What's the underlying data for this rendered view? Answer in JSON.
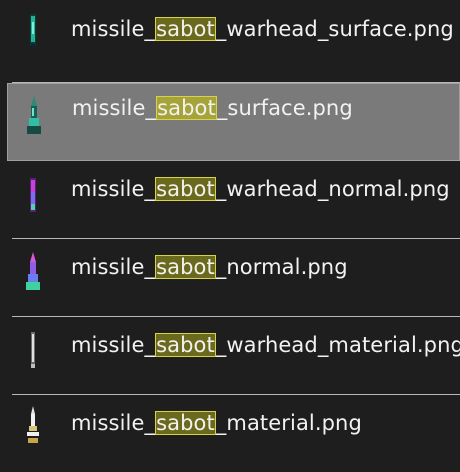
{
  "files": [
    {
      "prefix": "missile_",
      "match": "sabot",
      "suffix": "_warhead_surface.png",
      "selected": false,
      "icon": "warhead-surface-thumb"
    },
    {
      "prefix": "missile_",
      "match": "sabot",
      "suffix": "_surface.png",
      "selected": true,
      "icon": "missile-surface-thumb"
    },
    {
      "prefix": "missile_",
      "match": "sabot",
      "suffix": "_warhead_normal.png",
      "selected": false,
      "icon": "warhead-normal-thumb"
    },
    {
      "prefix": "missile_",
      "match": "sabot",
      "suffix": "_normal.png",
      "selected": false,
      "icon": "missile-normal-thumb"
    },
    {
      "prefix": "missile_",
      "match": "sabot",
      "suffix": "_warhead_material.png",
      "selected": false,
      "icon": "warhead-material-thumb"
    },
    {
      "prefix": "missile_",
      "match": "sabot",
      "suffix": "_material.png",
      "selected": false,
      "icon": "missile-material-thumb"
    }
  ],
  "colors": {
    "background": "#1e1e1e",
    "selected_row": "#7a7a7a",
    "match_highlight": "#6b6a1c",
    "match_outline": "#d6d24a"
  }
}
